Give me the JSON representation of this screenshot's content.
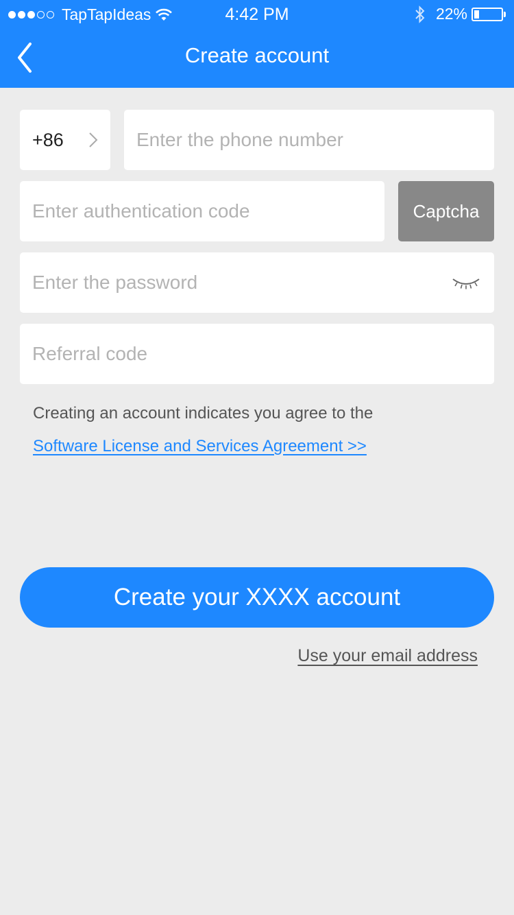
{
  "status_bar": {
    "carrier": "TapTapIdeas",
    "time": "4:42 PM",
    "battery": "22%",
    "signal_dots_filled": 3,
    "signal_dots_total": 5
  },
  "nav": {
    "title": "Create account",
    "back_icon": "chevron-left-icon"
  },
  "form": {
    "country_code": "+86",
    "phone_placeholder": "Enter the phone number",
    "auth_placeholder": "Enter authentication code",
    "captcha_label": "Captcha",
    "password_placeholder": "Enter the password",
    "referral_placeholder": "Referral code"
  },
  "agreement": {
    "text": "Creating an account indicates you agree to the",
    "link": "Software License and Services Agreement >>"
  },
  "actions": {
    "create_label": "Create your XXXX account",
    "email_link": "Use your email address"
  },
  "colors": {
    "accent": "#1e88ff",
    "background": "#ececec",
    "captcha_bg": "#888888"
  }
}
